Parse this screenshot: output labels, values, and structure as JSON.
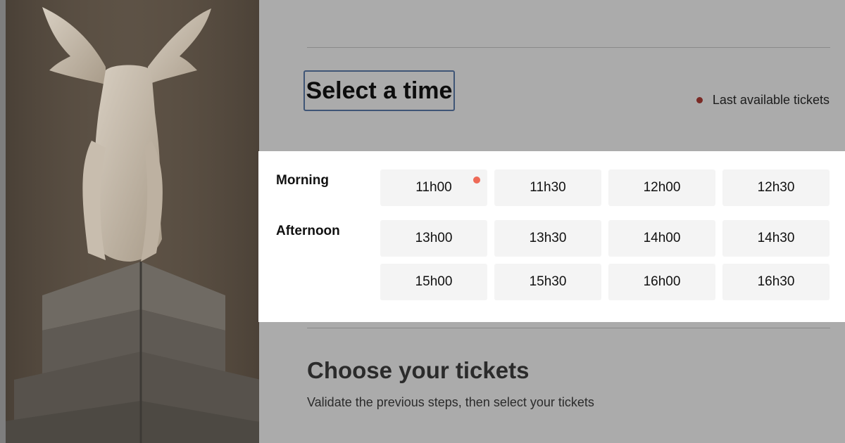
{
  "time_selection": {
    "title": "Select a time",
    "legend": {
      "label": "Last available tickets",
      "dot_color": "#7a2a25",
      "icon": "status-dot-icon"
    },
    "periods": [
      {
        "label": "Morning",
        "slots": [
          {
            "time": "11h00",
            "last_available": true
          },
          {
            "time": "11h30",
            "last_available": false
          },
          {
            "time": "12h00",
            "last_available": false
          },
          {
            "time": "12h30",
            "last_available": false
          }
        ]
      },
      {
        "label": "Afternoon",
        "slots": [
          {
            "time": "13h00",
            "last_available": false
          },
          {
            "time": "13h30",
            "last_available": false
          },
          {
            "time": "14h00",
            "last_available": false
          },
          {
            "time": "14h30",
            "last_available": false
          },
          {
            "time": "15h00",
            "last_available": false
          },
          {
            "time": "15h30",
            "last_available": false
          },
          {
            "time": "16h00",
            "last_available": false
          },
          {
            "time": "16h30",
            "last_available": false
          }
        ]
      }
    ],
    "availability_dot_color": "#ee6a57"
  },
  "tickets_section": {
    "title": "Choose your tickets",
    "subtitle": "Validate the previous steps, then select your tickets"
  },
  "colors": {
    "overlay": "#ababab",
    "panel": "#ffffff",
    "slot_bg": "#f4f4f4",
    "focus_ring": "#3f5576"
  }
}
